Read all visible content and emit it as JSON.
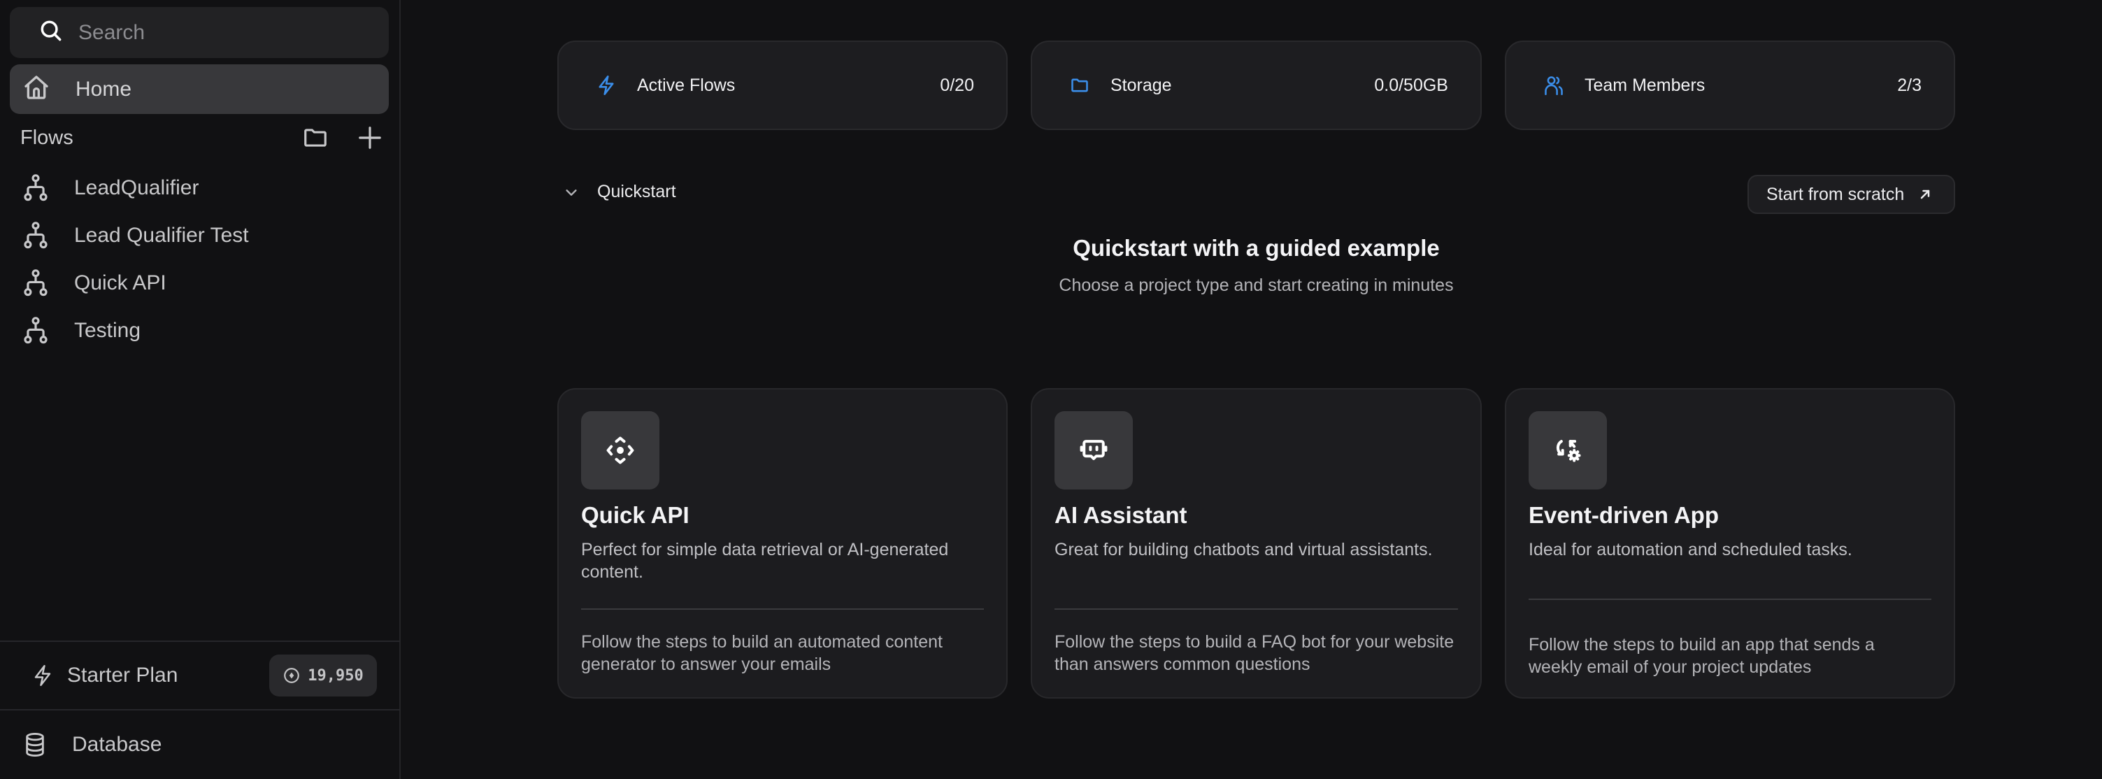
{
  "sidebar": {
    "search_placeholder": "Search",
    "home_label": "Home",
    "flows_title": "Flows",
    "flows": [
      {
        "label": "LeadQualifier",
        "icon": "flow-icon"
      },
      {
        "label": "Lead Qualifier Test",
        "icon": "flow-icon"
      },
      {
        "label": "Quick API",
        "icon": "flow-icon"
      },
      {
        "label": "Testing",
        "icon": "flow-icon"
      }
    ],
    "plan_label": "Starter Plan",
    "credits": "19,950",
    "database_label": "Database"
  },
  "stats": [
    {
      "label": "Active Flows",
      "value": "0/20",
      "icon": "bolt-icon"
    },
    {
      "label": "Storage",
      "value": "0.0/50GB",
      "icon": "folder-icon"
    },
    {
      "label": "Team Members",
      "value": "2/3",
      "icon": "users-icon"
    }
  ],
  "quickstart": {
    "toggle_label": "Quickstart",
    "scratch_button": "Start from scratch",
    "heading": "Quickstart with a guided example",
    "subheading": "Choose a project type and start creating in minutes",
    "cards": [
      {
        "title": "Quick API",
        "description": "Perfect for simple data retrieval or AI-generated content.",
        "steps": "Follow the steps to build an automated content generator to answer your emails",
        "icon": "api-icon"
      },
      {
        "title": "AI Assistant",
        "description": "Great for building chatbots and virtual assistants.",
        "steps": "Follow the steps to build a FAQ bot for your website than answers common questions",
        "icon": "bot-icon"
      },
      {
        "title": "Event-driven App",
        "description": "Ideal for automation and scheduled tasks.",
        "steps": "Follow the steps to build an app that sends a weekly email of your project updates",
        "icon": "event-cycle-icon"
      }
    ]
  },
  "colors": {
    "accent": "#3b8eea",
    "background": "#111113",
    "card": "#1d1d20"
  }
}
